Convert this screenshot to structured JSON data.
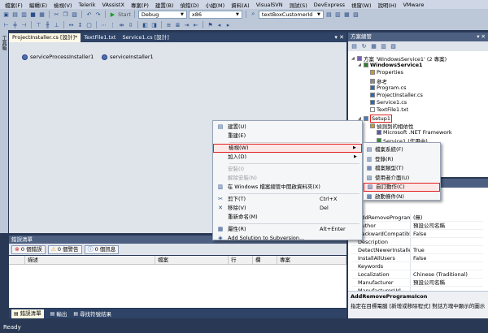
{
  "menubar": {
    "items": [
      "檔案(F)",
      "編輯(E)",
      "檢視(V)",
      "Telerik",
      "VAssistX",
      "專案(P)",
      "建置(B)",
      "偵錯(D)",
      "小組(M)",
      "資料(A)",
      "VisualSVN",
      "測試(S)",
      "DevExpress",
      "視窗(W)",
      "說明(H)",
      "VMware"
    ]
  },
  "toolbar": {
    "start_label": "Start",
    "config": "Debug",
    "platform": "x86",
    "search": "textBoxCustomerId"
  },
  "toolbox": {
    "label": "工具箱"
  },
  "document": {
    "tabs": [
      {
        "label": "ProjectInstaller.cs [設計]*",
        "active": true
      },
      {
        "label": "TextFile1.txt",
        "active": false
      },
      {
        "label": "Service1.cs [設計]",
        "active": false
      }
    ],
    "components": [
      "serviceProcessInstaller1",
      "serviceInstaller1"
    ]
  },
  "solution_explorer": {
    "title": "方案總管",
    "items": [
      {
        "label": "方案 'WindowsService1' (2 專案)",
        "indent": 0
      },
      {
        "label": "WindowsService1",
        "indent": 1,
        "bold": true
      },
      {
        "label": "Properties",
        "indent": 2
      },
      {
        "label": "參考",
        "indent": 2
      },
      {
        "label": "Program.cs",
        "indent": 2
      },
      {
        "label": "ProjectInstaller.cs",
        "indent": 2
      },
      {
        "label": "Service1.cs",
        "indent": 2
      },
      {
        "label": "TextFile1.txt",
        "indent": 2
      },
      {
        "label": "Setup1",
        "indent": 1,
        "highlight": true
      },
      {
        "label": "偵測到的相依性",
        "indent": 2
      },
      {
        "label": "Microsoft .NET Framework",
        "indent": 3
      },
      {
        "label": "Service1 (作用中)",
        "indent": 3
      },
      {
        "label": "Service1 (作用中)",
        "indent": 3
      }
    ],
    "tab_label": "檢視"
  },
  "context_menu": {
    "items": [
      {
        "label": "建置(U)",
        "icon": "build-icon",
        "disabled": false
      },
      {
        "label": "重建(E)",
        "icon": "",
        "disabled": false
      },
      {
        "sep": true
      },
      {
        "label": "檢視(W)",
        "icon": "",
        "submenu": true,
        "selected": true
      },
      {
        "label": "加入(D)",
        "icon": "",
        "submenu": true
      },
      {
        "sep": true
      },
      {
        "label": "安裝(I)",
        "icon": "",
        "disabled": true
      },
      {
        "label": "解除安裝(N)",
        "icon": "",
        "disabled": true
      },
      {
        "label": "在 Windows 檔案總管中開啟資料夾(X)",
        "icon": "folder-icon"
      },
      {
        "sep": true
      },
      {
        "label": "剪下(T)",
        "icon": "cut-icon",
        "shortcut": "Ctrl+X"
      },
      {
        "label": "移除(V)",
        "icon": "delete-icon",
        "shortcut": "Del"
      },
      {
        "label": "重新命名(M)",
        "icon": ""
      },
      {
        "sep": true
      },
      {
        "label": "屬性(R)",
        "icon": "properties-icon",
        "shortcut": "Alt+Enter"
      },
      {
        "label": "Add Solution to Subversion...",
        "icon": "svn-icon"
      }
    ]
  },
  "submenu": {
    "items": [
      {
        "label": "檔案系統(F)",
        "icon": "filesystem-icon"
      },
      {
        "label": "登錄(R)",
        "icon": "registry-icon"
      },
      {
        "label": "檔案類型(T)",
        "icon": "filetypes-icon"
      },
      {
        "label": "使用者介面(U)",
        "icon": "ui-icon"
      },
      {
        "label": "自訂動作(C)",
        "icon": "custom-actions-icon",
        "selected": true
      },
      {
        "label": "啟動條件(N)",
        "icon": "launch-conditions-icon"
      }
    ]
  },
  "properties": {
    "rows": [
      {
        "k": "AddRemoveProgramsI",
        "v": "(無)"
      },
      {
        "k": "Author",
        "v": "預設公司名稱"
      },
      {
        "k": "BackwardCompatibleI",
        "v": "False"
      },
      {
        "k": "Description",
        "v": ""
      },
      {
        "k": "DetectNewerInstalledV",
        "v": "True"
      },
      {
        "k": "InstallAllUsers",
        "v": "False"
      },
      {
        "k": "Keywords",
        "v": ""
      },
      {
        "k": "Localization",
        "v": "Chinese (Traditional)"
      },
      {
        "k": "Manufacturer",
        "v": "預設公司名稱"
      },
      {
        "k": "ManufacturerUrl",
        "v": ""
      }
    ],
    "desc_title": "AddRemoveProgramsIcon",
    "desc_text": "指定在目標電腦 [新增或移除程式] 對話方塊中顯示的圖示"
  },
  "error_list": {
    "title": "錯誤清單",
    "buttons": [
      {
        "label": "0 個錯誤",
        "icon": "error-icon",
        "color": "#d02020"
      },
      {
        "label": "0 個警告",
        "icon": "warning-icon",
        "color": "#e0a000"
      },
      {
        "label": "0 個訊息",
        "icon": "info-icon",
        "color": "#2060c0"
      }
    ],
    "columns": [
      "",
      "描述",
      "檔案",
      "行",
      "欄",
      "專案"
    ],
    "tabs": [
      {
        "label": "錯誤清單",
        "active": true
      },
      {
        "label": "輸出",
        "active": false
      },
      {
        "label": "尋找符號結果",
        "active": false
      }
    ]
  },
  "status": {
    "text": "Ready"
  }
}
